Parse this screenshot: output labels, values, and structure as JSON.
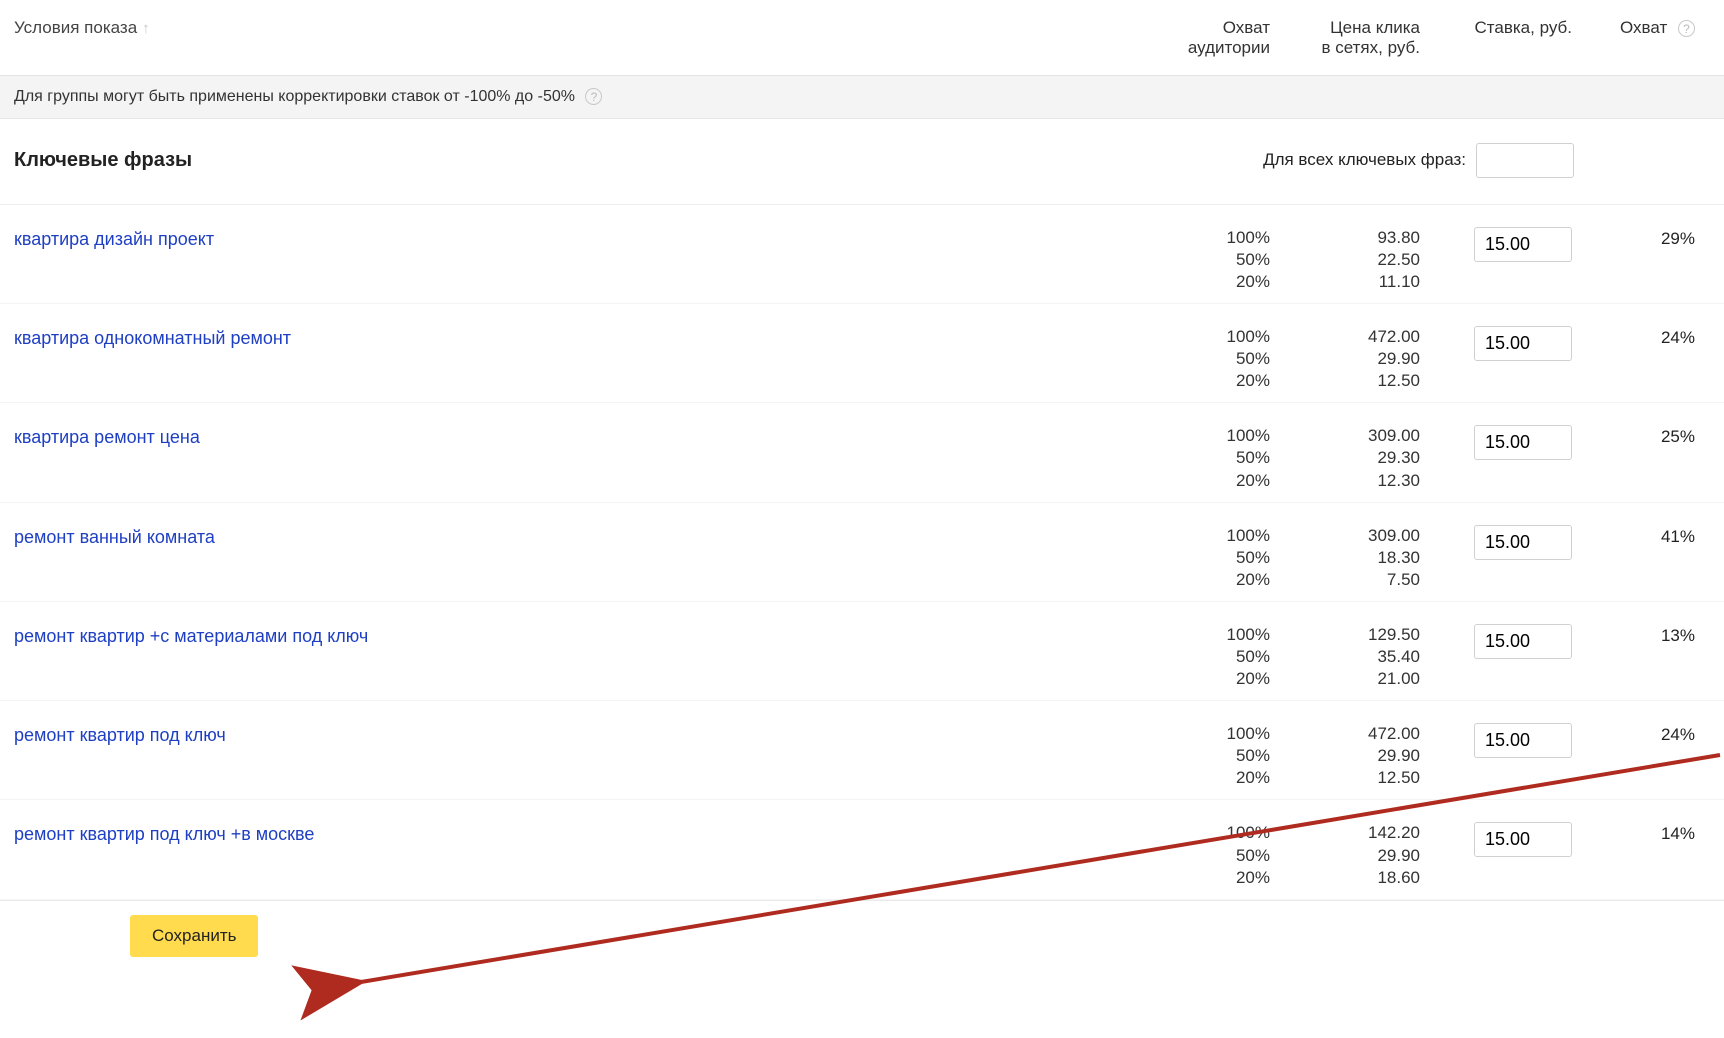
{
  "header": {
    "conditions": "Условия показа",
    "audience": "Охват\nаудитории",
    "cpc": "Цена клика\nв сетях, руб.",
    "bid": "Ставка, руб.",
    "reach": "Охват"
  },
  "notice": "Для группы могут быть применены корректировки ставок от -100% до -50%",
  "keywords_header": {
    "title": "Ключевые фразы",
    "all_label": "Для всех ключевых фраз:"
  },
  "rows": [
    {
      "keyword": "квартира дизайн проект",
      "pcts": [
        "100%",
        "50%",
        "20%"
      ],
      "prices": [
        "93.80",
        "22.50",
        "11.10"
      ],
      "bid": "15.00",
      "reach": "29%"
    },
    {
      "keyword": "квартира однокомнатный ремонт",
      "pcts": [
        "100%",
        "50%",
        "20%"
      ],
      "prices": [
        "472.00",
        "29.90",
        "12.50"
      ],
      "bid": "15.00",
      "reach": "24%"
    },
    {
      "keyword": "квартира ремонт цена",
      "pcts": [
        "100%",
        "50%",
        "20%"
      ],
      "prices": [
        "309.00",
        "29.30",
        "12.30"
      ],
      "bid": "15.00",
      "reach": "25%"
    },
    {
      "keyword": "ремонт ванный комната",
      "pcts": [
        "100%",
        "50%",
        "20%"
      ],
      "prices": [
        "309.00",
        "18.30",
        "7.50"
      ],
      "bid": "15.00",
      "reach": "41%"
    },
    {
      "keyword": "ремонт квартир +с материалами под ключ",
      "pcts": [
        "100%",
        "50%",
        "20%"
      ],
      "prices": [
        "129.50",
        "35.40",
        "21.00"
      ],
      "bid": "15.00",
      "reach": "13%"
    },
    {
      "keyword": "ремонт квартир под ключ",
      "pcts": [
        "100%",
        "50%",
        "20%"
      ],
      "prices": [
        "472.00",
        "29.90",
        "12.50"
      ],
      "bid": "15.00",
      "reach": "24%"
    },
    {
      "keyword": "ремонт квартир под ключ +в москве",
      "pcts": [
        "100%",
        "50%",
        "20%"
      ],
      "prices": [
        "142.20",
        "29.90",
        "18.60"
      ],
      "bid": "15.00",
      "reach": "14%"
    }
  ],
  "footer": {
    "save": "Сохранить"
  }
}
